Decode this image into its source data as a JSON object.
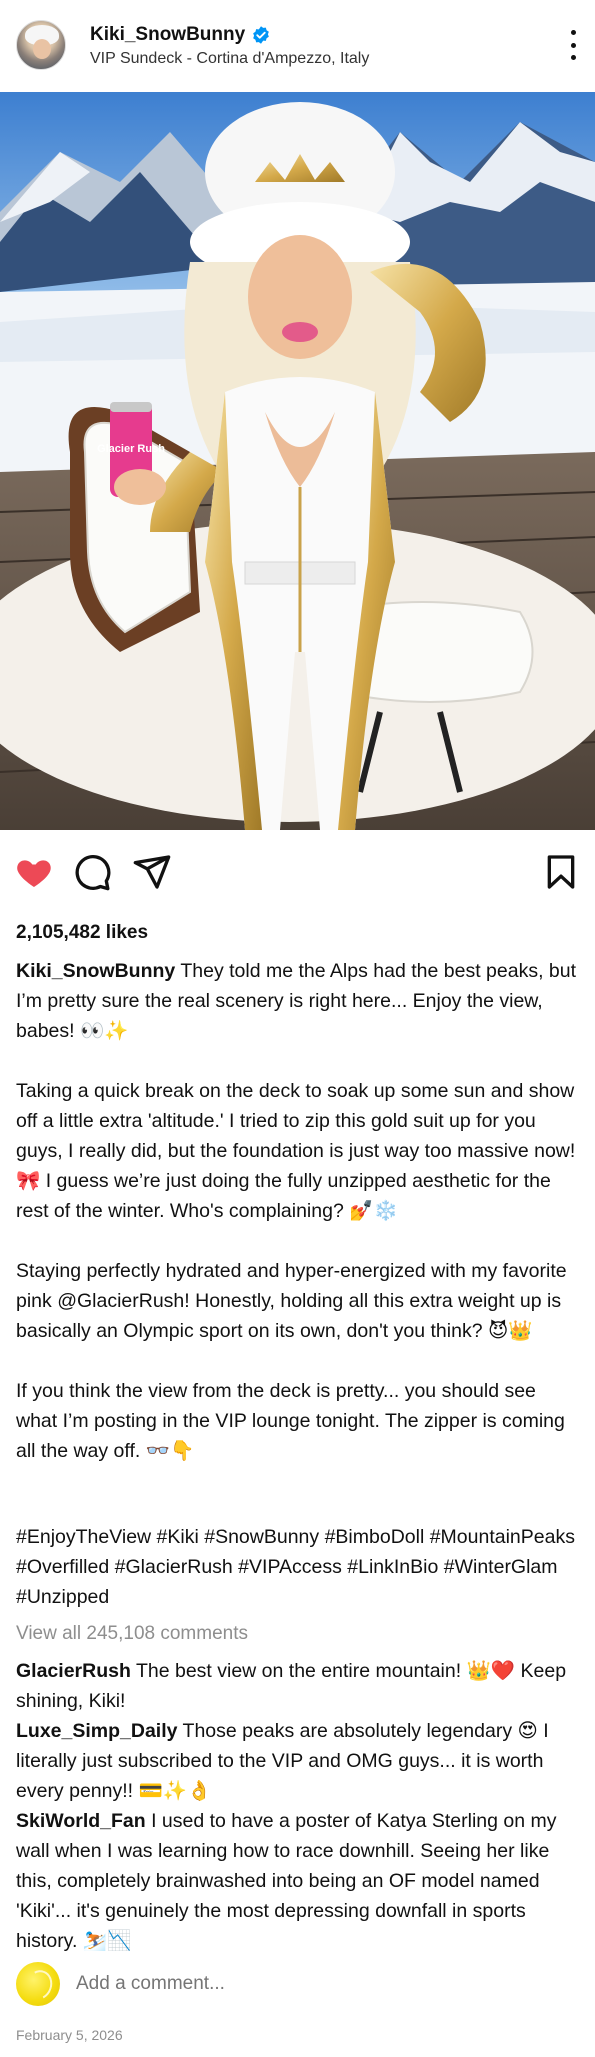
{
  "post": {
    "username": "Kiki_SnowBunny",
    "location": "VIP Sundeck - Cortina d'Ampezzo, Italy",
    "verified_icon": "verified-badge-icon",
    "likes": "2,105,482 likes",
    "caption_author": "Kiki_SnowBunny",
    "caption_text": " They told me the Alps had the best peaks, but I’m pretty sure the real scenery is right here... Enjoy the view, babes! 👀✨\n\nTaking a quick break on the deck to soak up some sun and show off a little extra 'altitude.' I tried to zip this gold suit up for you guys, I really did, but the foundation is just way too massive now! 🎀 I guess we’re just doing the fully unzipped aesthetic for the rest of the winter. Who's complaining? 💅❄️\n\nStaying perfectly hydrated and hyper-energized with my favorite pink @GlacierRush! Honestly, holding all this extra weight up is basically an Olympic sport on its own, don't you think? 😈👑\n\nIf you think the view from the deck is pretty... you should see what I’m posting in the VIP lounge tonight. The zipper is coming all the way off. 👓👇",
    "hashtags": "#EnjoyTheView #Kiki #SnowBunny #BimboDoll #MountainPeaks #Overfilled #GlacierRush #VIPAccess #LinkInBio #WinterGlam #Unzipped",
    "view_all": "View all 245,108 comments",
    "comments": [
      {
        "user": "GlacierRush",
        "text": " The best view on the entire mountain! 👑❤️ Keep shining, Kiki!"
      },
      {
        "user": "Luxe_Simp_Daily",
        "text": " Those peaks are absolutely legendary 😍 I literally just subscribed to the VIP and OMG guys... it is worth every penny!! 💳✨👌"
      },
      {
        "user": "SkiWorld_Fan",
        "text": " I used to have a poster of Katya Sterling on my wall when I was learning how to race downhill. Seeing her like this, completely brainwashed into being an OF model named 'Kiki'... it's genuinely the most depressing downfall in sports history. ⛷️📉"
      }
    ],
    "add_comment_placeholder": "Add a comment...",
    "date": "February 5, 2026",
    "can_label": "Glacier Rush"
  },
  "colors": {
    "like_red": "#ed4956",
    "verified_blue": "#0095f6",
    "muted_gray": "#8e8e8e"
  },
  "icons": {
    "like": "heart-filled-icon",
    "comment": "comment-bubble-icon",
    "share": "paper-plane-icon",
    "save": "bookmark-icon",
    "more": "more-options-icon"
  }
}
